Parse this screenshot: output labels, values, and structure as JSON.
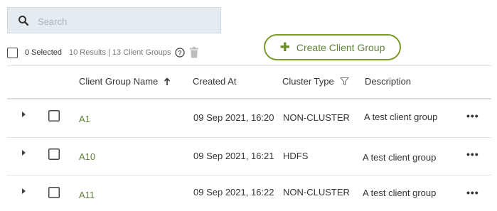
{
  "search": {
    "placeholder": "Search",
    "icon": "search-icon"
  },
  "toolbar": {
    "selected_label": "0 Selected",
    "results_text": "10 Results | 13 Client Groups",
    "create_label": "Create Client Group"
  },
  "table": {
    "columns": {
      "name": "Client Group Name",
      "created": "Created At",
      "cluster": "Cluster Type",
      "description": "Description"
    },
    "rows": [
      {
        "name": "A1",
        "created": "09 Sep 2021, 16:20",
        "cluster": "NON-CLUSTER",
        "description": "A test client group"
      },
      {
        "name": "A10",
        "created": "09 Sep 2021, 16:21",
        "cluster": "HDFS",
        "description": "A test client group"
      },
      {
        "name": "A11",
        "created": "09 Sep 2021, 16:22",
        "cluster": "NON-CLUSTER",
        "description": "A test client group"
      }
    ]
  },
  "colors": {
    "accent": "#6a8d2a",
    "name_link": "#5f7f3a",
    "search_bg": "#e4ebf1"
  }
}
